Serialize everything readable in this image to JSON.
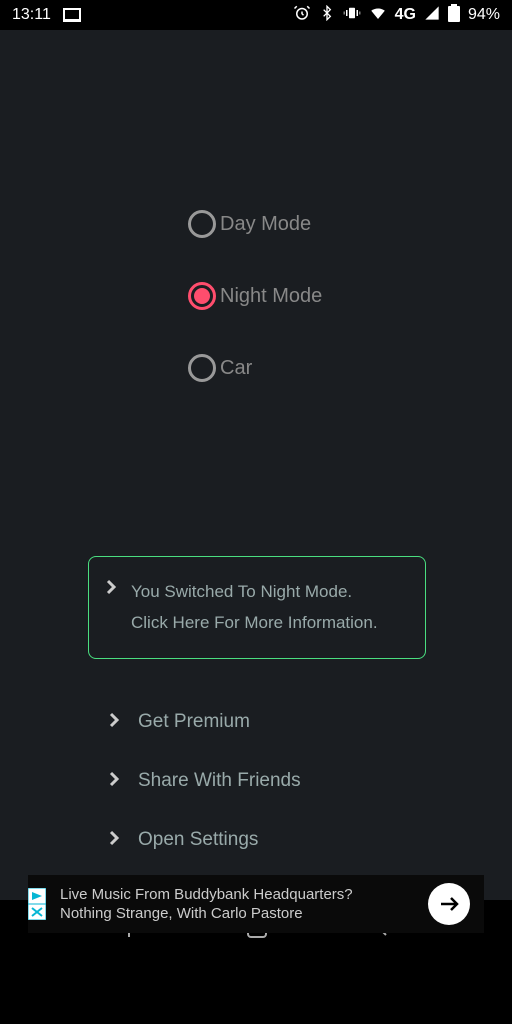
{
  "status_bar": {
    "time": "13:11",
    "network": "4G",
    "battery": "94%"
  },
  "modes": {
    "items": [
      {
        "label": "Day Mode",
        "selected": false
      },
      {
        "label": "Night Mode",
        "selected": true
      },
      {
        "label": "Car",
        "selected": false
      }
    ]
  },
  "info_box": {
    "line1": "You Switched To Night Mode.",
    "line2": "Click Here For More Information."
  },
  "menu": {
    "items": [
      {
        "label": "Get Premium"
      },
      {
        "label": "Share With Friends"
      },
      {
        "label": "Open Settings"
      }
    ]
  },
  "ad": {
    "line1": "Live Music From Buddybank Headquarters?",
    "line2": "Nothing Strange, With Carlo Pastore"
  }
}
